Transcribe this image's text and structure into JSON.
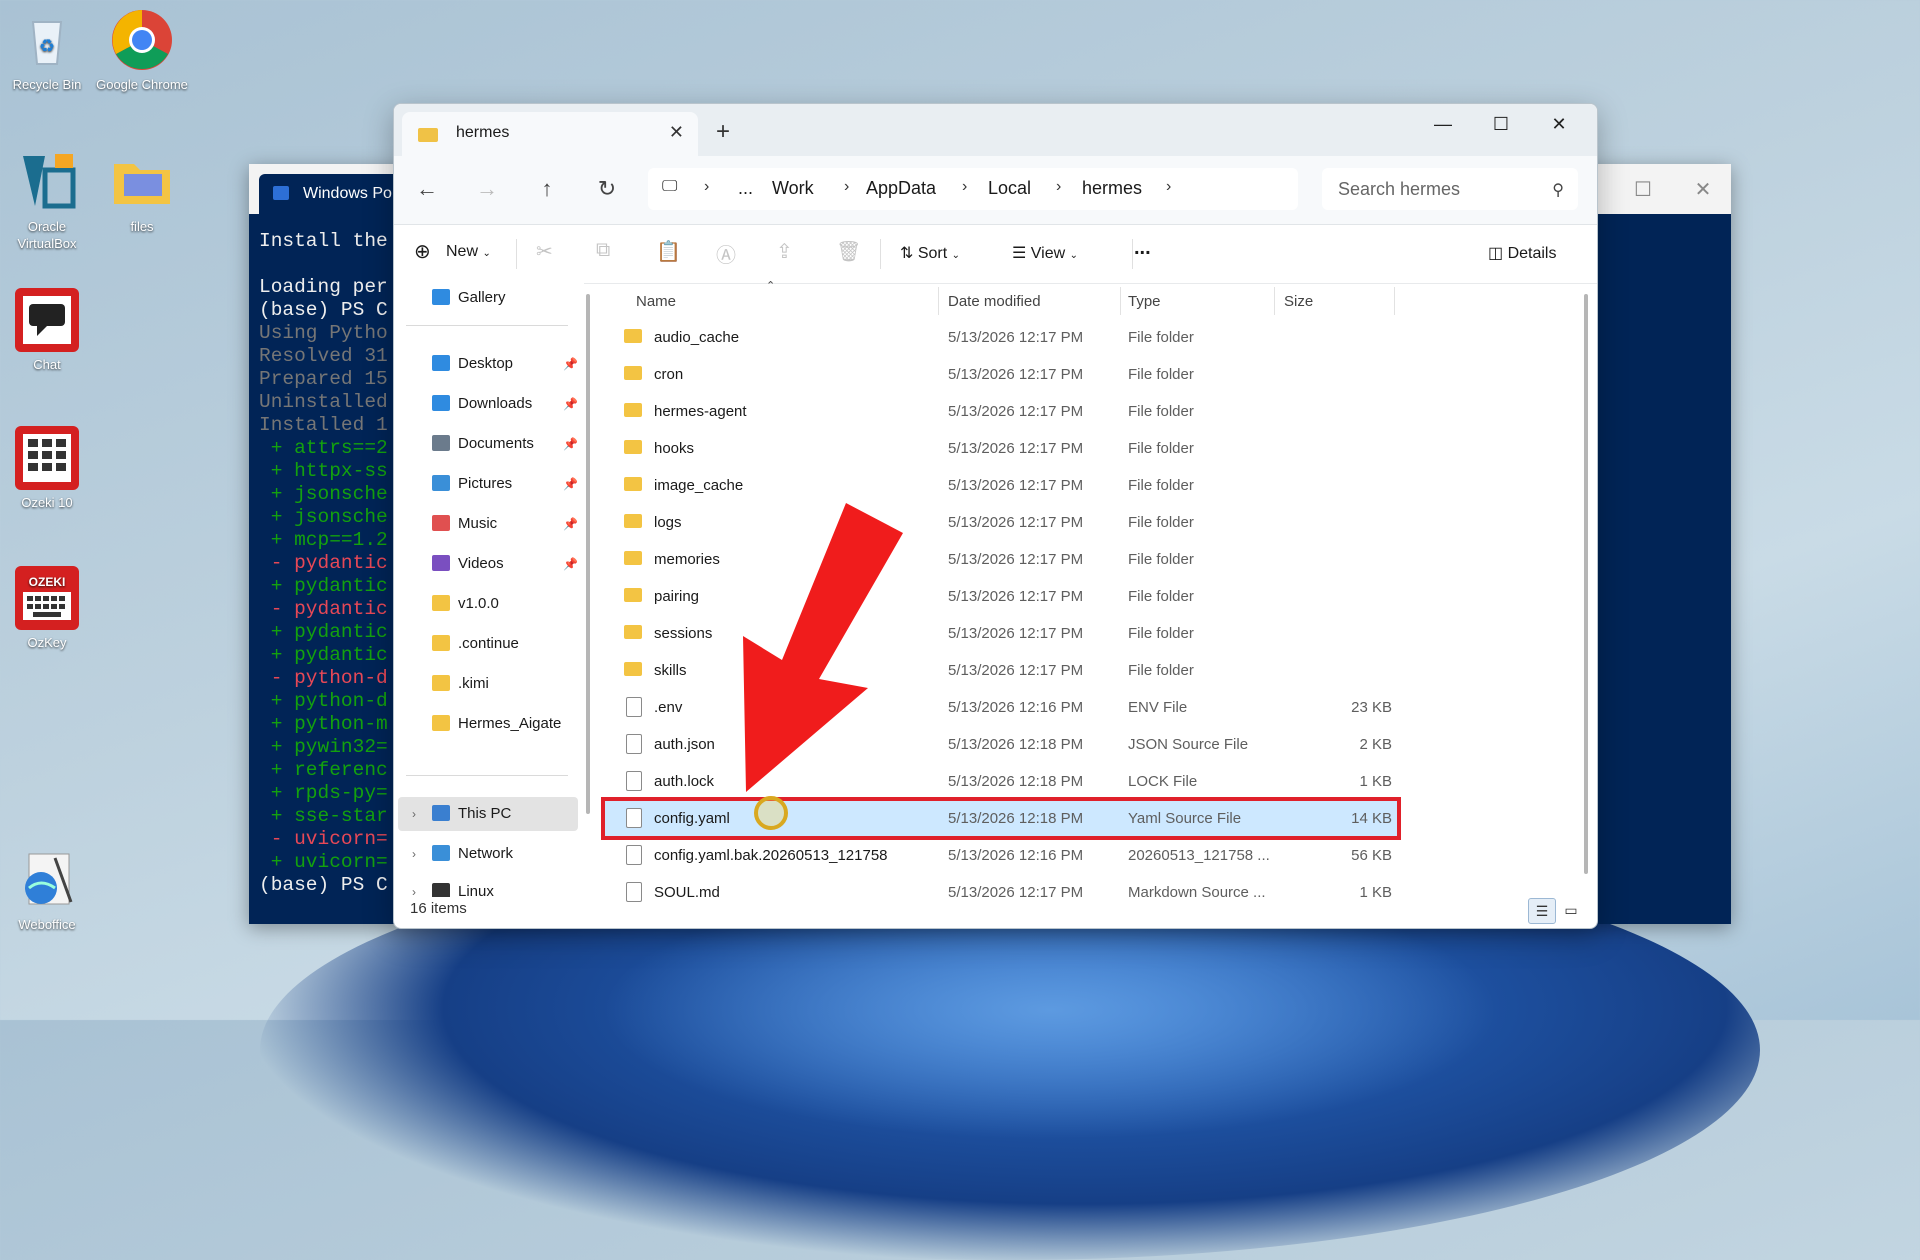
{
  "desktop": {
    "icons": [
      {
        "label": "Recycle Bin"
      },
      {
        "label": "Google Chrome"
      },
      {
        "label": "Oracle VirtualBox"
      },
      {
        "label": "files"
      },
      {
        "label": "Chat"
      },
      {
        "label": "Ozeki 10"
      },
      {
        "label": "OzKey"
      },
      {
        "label": "Weboffice"
      }
    ]
  },
  "powershell": {
    "tab_title": "Windows Po",
    "lines": [
      "Install the",
      "",
      "Loading per",
      "(base) PS C",
      "Using Pytho",
      "Resolved 31",
      "Prepared 15",
      "Uninstalled",
      "Installed 1",
      " + attrs==2",
      " + httpx-ss",
      " + jsonsche",
      " + jsonsche",
      " + mcp==1.2",
      " - pydantic",
      " + pydantic",
      " - pydantic",
      " + pydantic",
      " + pydantic",
      " - python-d",
      " + python-d",
      " + python-m",
      " + pywin32=",
      " + referenc",
      " + rpds-py=",
      " + sse-star",
      " - uvicorn=",
      " + uvicorn=",
      "(base) PS C"
    ]
  },
  "explorer": {
    "tab_title": "hermes",
    "breadcrumbs": [
      "...",
      "Work",
      "AppData",
      "Local",
      "hermes"
    ],
    "search_placeholder": "Search hermes",
    "commands": {
      "new": "New",
      "sort": "Sort",
      "view": "View",
      "more": "...",
      "details": "Details"
    },
    "nav": {
      "gallery": "Gallery",
      "quick": [
        {
          "label": "Desktop",
          "color": "#2f8be0",
          "pinned": true
        },
        {
          "label": "Downloads",
          "color": "#2f8be0",
          "pinned": true
        },
        {
          "label": "Documents",
          "color": "#6b7b8c",
          "pinned": true
        },
        {
          "label": "Pictures",
          "color": "#3a8fd8",
          "pinned": true
        },
        {
          "label": "Music",
          "color": "#e05050",
          "pinned": true
        },
        {
          "label": "Videos",
          "color": "#7a4fc0",
          "pinned": true
        },
        {
          "label": "v1.0.0",
          "color": "#f3c443",
          "pinned": false
        },
        {
          "label": ".continue",
          "color": "#f3c443",
          "pinned": false
        },
        {
          "label": ".kimi",
          "color": "#f3c443",
          "pinned": false
        },
        {
          "label": "Hermes_Aigate",
          "color": "#f3c443",
          "pinned": false
        }
      ],
      "this_pc": "This PC",
      "network": "Network",
      "linux": "Linux"
    },
    "columns": {
      "name": "Name",
      "date": "Date modified",
      "type": "Type",
      "size": "Size"
    },
    "rows": [
      {
        "name": "audio_cache",
        "date": "5/13/2026 12:17 PM",
        "type": "File folder",
        "size": "",
        "kind": "folder"
      },
      {
        "name": "cron",
        "date": "5/13/2026 12:17 PM",
        "type": "File folder",
        "size": "",
        "kind": "folder"
      },
      {
        "name": "hermes-agent",
        "date": "5/13/2026 12:17 PM",
        "type": "File folder",
        "size": "",
        "kind": "folder"
      },
      {
        "name": "hooks",
        "date": "5/13/2026 12:17 PM",
        "type": "File folder",
        "size": "",
        "kind": "folder"
      },
      {
        "name": "image_cache",
        "date": "5/13/2026 12:17 PM",
        "type": "File folder",
        "size": "",
        "kind": "folder"
      },
      {
        "name": "logs",
        "date": "5/13/2026 12:17 PM",
        "type": "File folder",
        "size": "",
        "kind": "folder"
      },
      {
        "name": "memories",
        "date": "5/13/2026 12:17 PM",
        "type": "File folder",
        "size": "",
        "kind": "folder"
      },
      {
        "name": "pairing",
        "date": "5/13/2026 12:17 PM",
        "type": "File folder",
        "size": "",
        "kind": "folder"
      },
      {
        "name": "sessions",
        "date": "5/13/2026 12:17 PM",
        "type": "File folder",
        "size": "",
        "kind": "folder"
      },
      {
        "name": "skills",
        "date": "5/13/2026 12:17 PM",
        "type": "File folder",
        "size": "",
        "kind": "folder"
      },
      {
        "name": ".env",
        "date": "5/13/2026 12:16 PM",
        "type": "ENV File",
        "size": "23 KB",
        "kind": "file"
      },
      {
        "name": "auth.json",
        "date": "5/13/2026 12:18 PM",
        "type": "JSON Source File",
        "size": "2 KB",
        "kind": "file"
      },
      {
        "name": "auth.lock",
        "date": "5/13/2026 12:18 PM",
        "type": "LOCK File",
        "size": "1 KB",
        "kind": "file"
      },
      {
        "name": "config.yaml",
        "date": "5/13/2026 12:18 PM",
        "type": "Yaml Source File",
        "size": "14 KB",
        "kind": "file",
        "highlighted": true
      },
      {
        "name": "config.yaml.bak.20260513_121758",
        "date": "5/13/2026 12:16 PM",
        "type": "20260513_121758 ...",
        "size": "56 KB",
        "kind": "file"
      },
      {
        "name": "SOUL.md",
        "date": "5/13/2026 12:17 PM",
        "type": "Markdown Source ...",
        "size": "1 KB",
        "kind": "file"
      }
    ],
    "status": "16 items",
    "highlight_color": "#e0202a"
  }
}
